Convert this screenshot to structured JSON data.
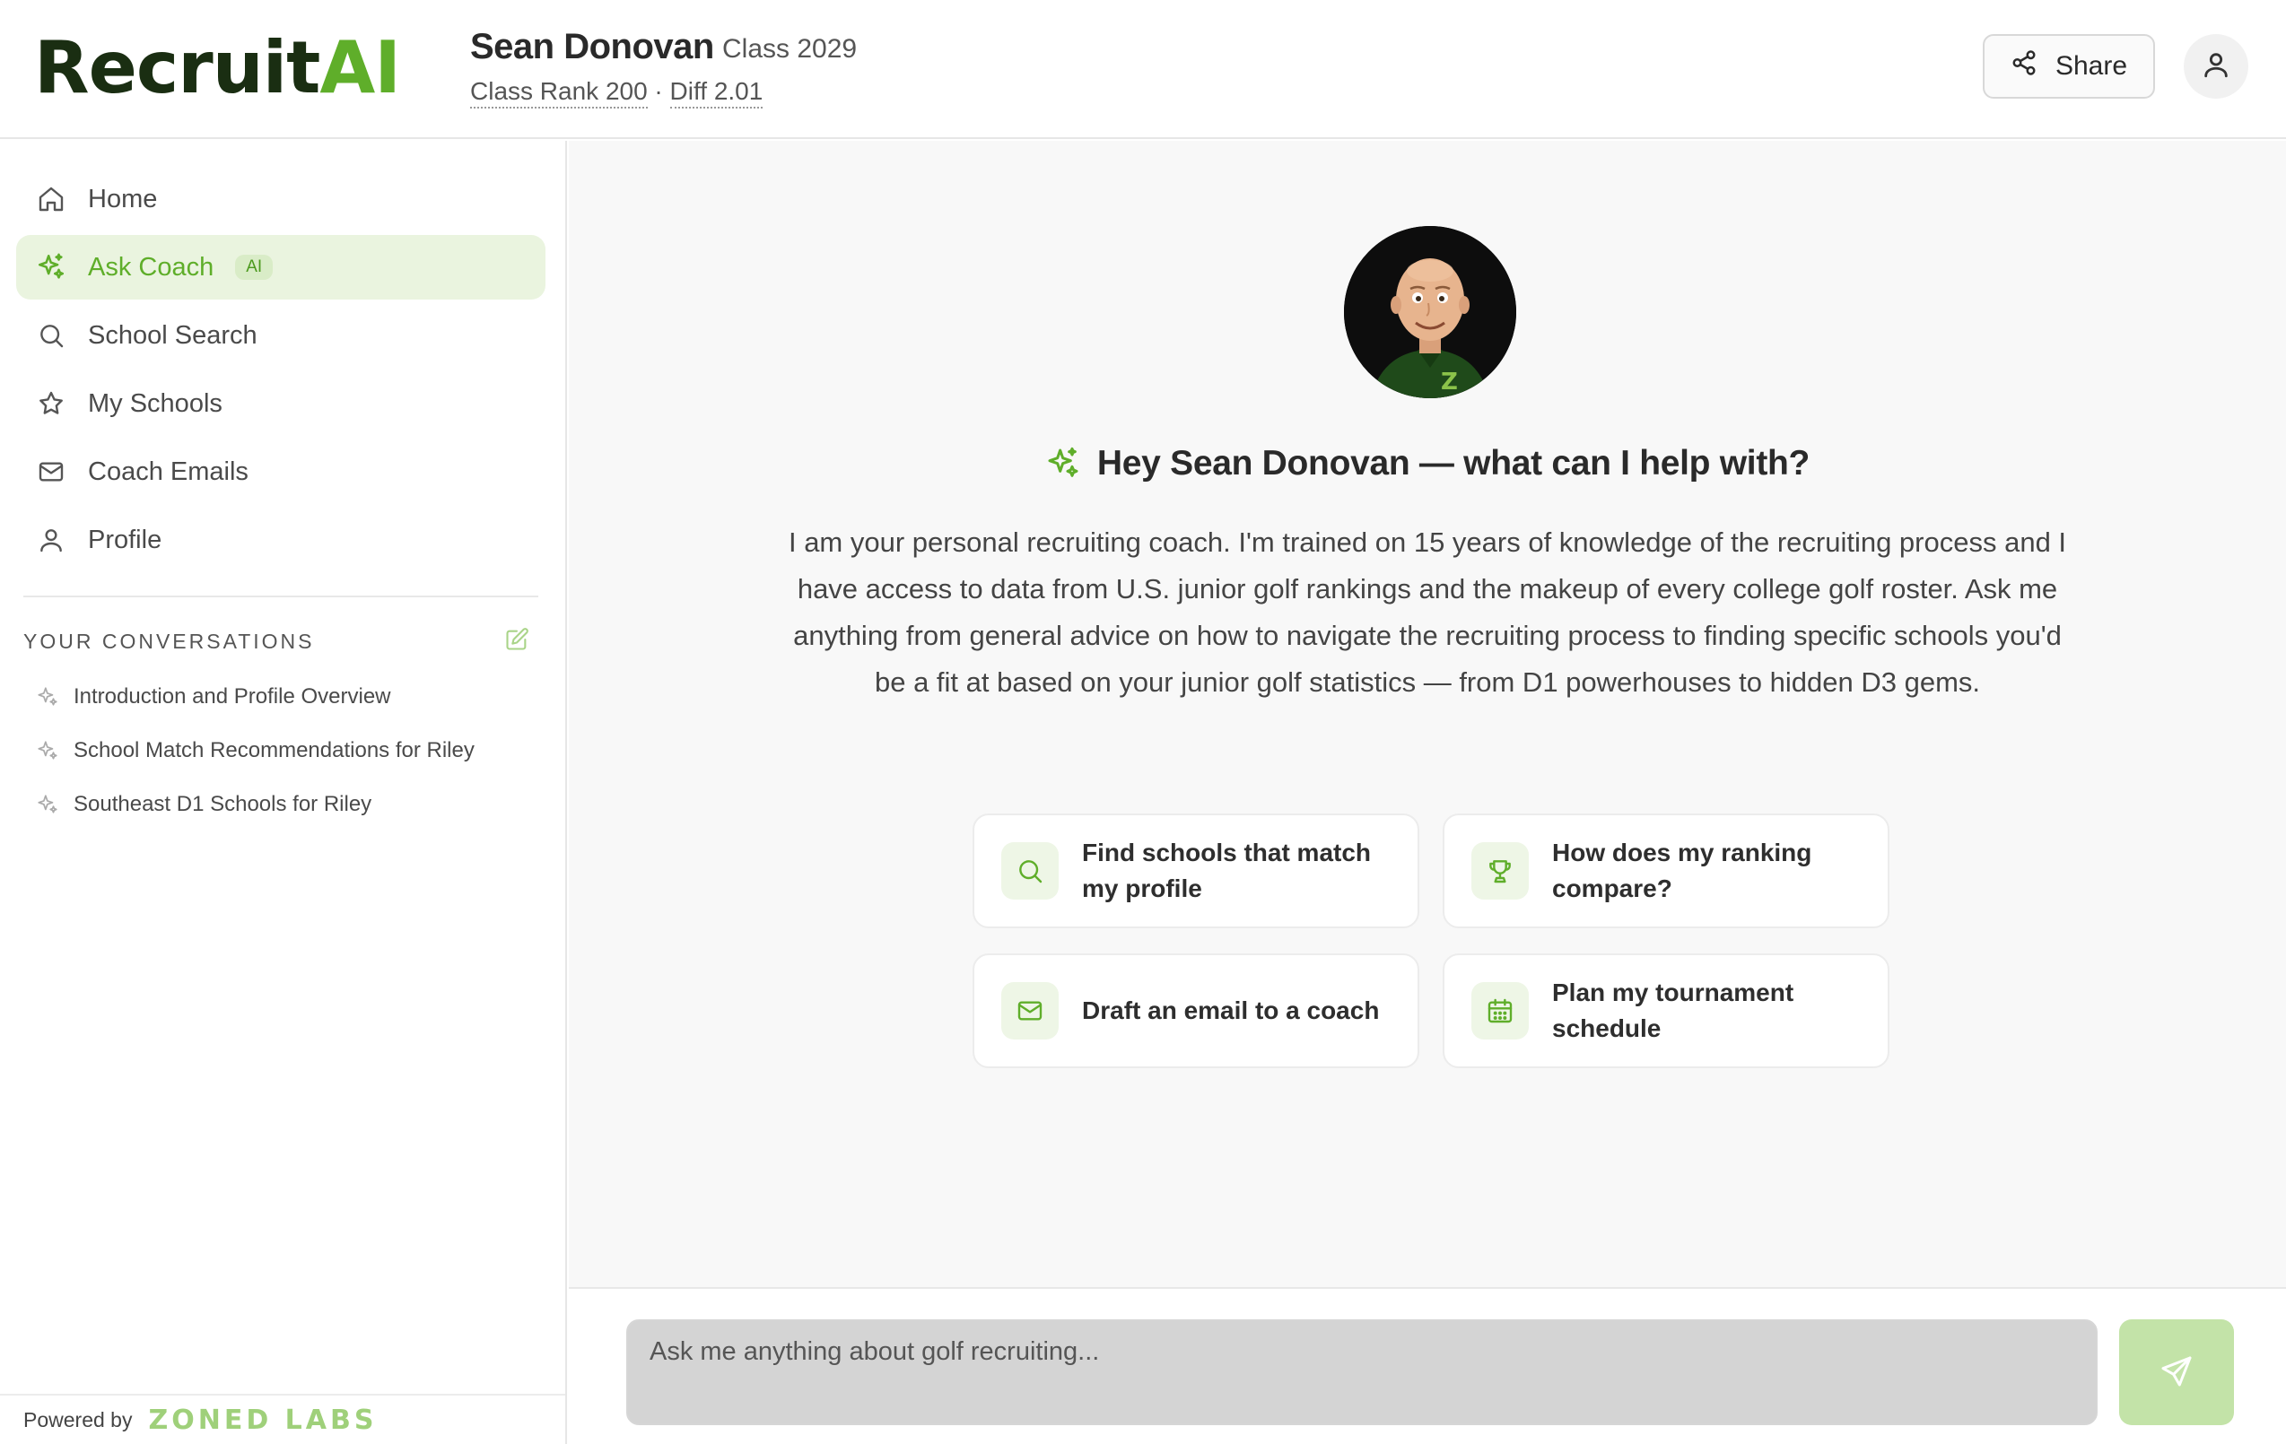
{
  "header": {
    "logo_part1": "Recruit",
    "logo_part2": "AI",
    "player_name": "Sean Donovan",
    "player_class": "Class 2029",
    "class_rank": "Class Rank 200",
    "stat_separator": " · ",
    "diff": "Diff 2.01",
    "share_label": "Share"
  },
  "sidebar": {
    "nav": [
      {
        "label": "Home",
        "icon": "home-icon"
      },
      {
        "label": "Ask Coach",
        "icon": "sparkle-icon",
        "badge": "AI",
        "active": true
      },
      {
        "label": "School Search",
        "icon": "search-icon"
      },
      {
        "label": "My Schools",
        "icon": "star-icon"
      },
      {
        "label": "Coach Emails",
        "icon": "mail-icon"
      },
      {
        "label": "Profile",
        "icon": "user-icon"
      }
    ],
    "conversations_title": "YOUR CONVERSATIONS",
    "conversations": [
      {
        "title": "Introduction and Profile Overview"
      },
      {
        "title": "School Match Recommendations for Riley"
      },
      {
        "title": "Southeast D1 Schools for Riley"
      }
    ],
    "powered_by": "Powered by",
    "brand": "ZONED LABS"
  },
  "main": {
    "greeting": "Hey Sean Donovan — what can I help with?",
    "intro": "I am your personal recruiting coach. I'm trained on 15 years of knowledge of the recruiting process and I have access to data from U.S. junior golf rankings and the makeup of every college golf roster. Ask me anything from general advice on how to navigate the recruiting process to finding specific schools you'd be a fit at based on your junior golf statistics — from D1 powerhouses to hidden D3 gems.",
    "suggestions": [
      {
        "label": "Find schools that match my profile",
        "icon": "search-icon"
      },
      {
        "label": "How does my ranking compare?",
        "icon": "trophy-icon"
      },
      {
        "label": "Draft an email to a coach",
        "icon": "mail-icon"
      },
      {
        "label": "Plan my tournament schedule",
        "icon": "calendar-icon"
      }
    ]
  },
  "input": {
    "placeholder": "Ask me anything about golf recruiting...",
    "value": ""
  },
  "colors": {
    "accent": "#5fae2a",
    "accent_light": "#eaf4df",
    "logo_dark": "#1a2e12"
  }
}
